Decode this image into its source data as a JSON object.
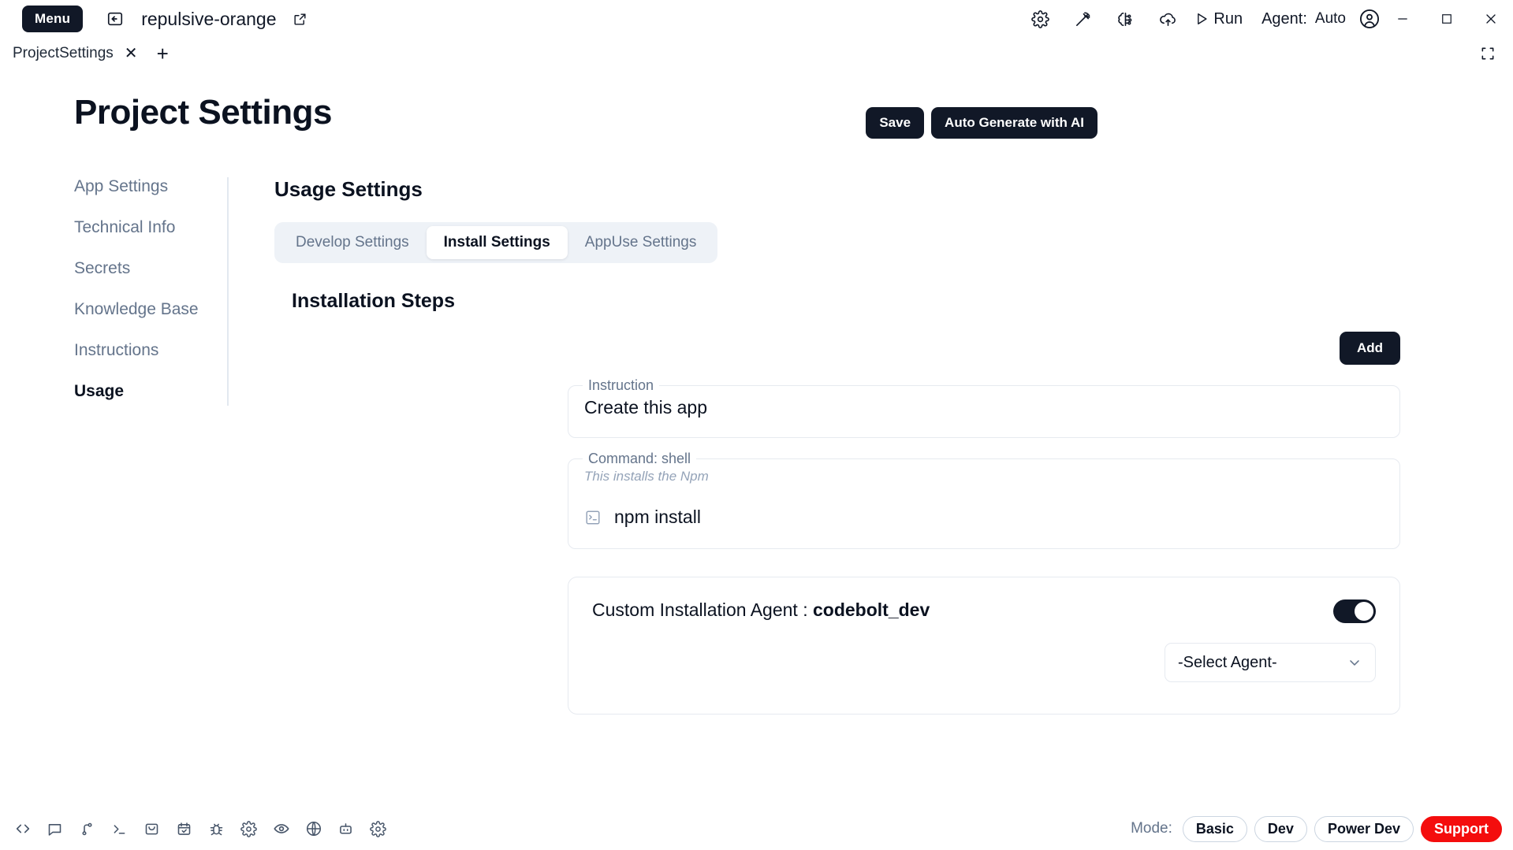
{
  "titlebar": {
    "menu_label": "Menu",
    "back_icon": "back-arrow-icon",
    "project_name": "repulsive-orange",
    "external_link_icon": "external-link-icon",
    "icons": [
      "gear-icon",
      "pickaxe-icon",
      "brain-circuit-icon",
      "cloud-upload-icon"
    ],
    "run_label": "Run",
    "agent_label": "Agent:",
    "agent_value": "Auto",
    "window_controls": [
      "minimize-icon",
      "maximize-icon",
      "close-icon"
    ]
  },
  "tabstrip": {
    "tabs": [
      {
        "label": "ProjectSettings",
        "close": "✕"
      }
    ],
    "add_tab": "+",
    "expand_icon": "fullscreen-icon"
  },
  "header": {
    "title": "Project Settings",
    "save_label": "Save",
    "auto_generate_label": "Auto Generate with AI"
  },
  "sidebar": {
    "items": [
      {
        "label": "App Settings",
        "active": false
      },
      {
        "label": "Technical Info",
        "active": false
      },
      {
        "label": "Secrets",
        "active": false
      },
      {
        "label": "Knowledge Base",
        "active": false
      },
      {
        "label": "Instructions",
        "active": false
      },
      {
        "label": "Usage",
        "active": true
      }
    ]
  },
  "main": {
    "section_title": "Usage Settings",
    "tabs": [
      {
        "label": "Develop Settings",
        "active": false
      },
      {
        "label": "Install Settings",
        "active": true
      },
      {
        "label": "AppUse Settings",
        "active": false
      }
    ],
    "subsection_title": "Installation Steps",
    "add_label": "Add",
    "instruction": {
      "legend": "Instruction",
      "value": "Create this app"
    },
    "command": {
      "legend": "Command: shell",
      "note": "This installs the Npm",
      "icon": "terminal-icon",
      "value": "npm install"
    },
    "agent_card": {
      "label_prefix": "Custom Installation Agent : ",
      "agent_name": "codebolt_dev",
      "toggle_on": true,
      "select_value": "-Select Agent-"
    }
  },
  "statusbar": {
    "icons": [
      "code-brackets-icon",
      "chat-bubble-icon",
      "git-branch-icon",
      "terminal-icon",
      "inbox-icon",
      "calendar-check-icon",
      "bug-icon",
      "gear-icon",
      "eye-icon",
      "globe-icon",
      "robot-icon",
      "settings-gear-icon"
    ],
    "mode_label": "Mode:",
    "modes": [
      {
        "label": "Basic",
        "variant": "default"
      },
      {
        "label": "Dev",
        "variant": "default"
      },
      {
        "label": "Power Dev",
        "variant": "default"
      },
      {
        "label": "Support",
        "variant": "danger"
      }
    ]
  },
  "colors": {
    "dark": "#111827",
    "accent_danger": "#f40d0d",
    "muted": "#64748b",
    "border": "#e6eaf0"
  }
}
